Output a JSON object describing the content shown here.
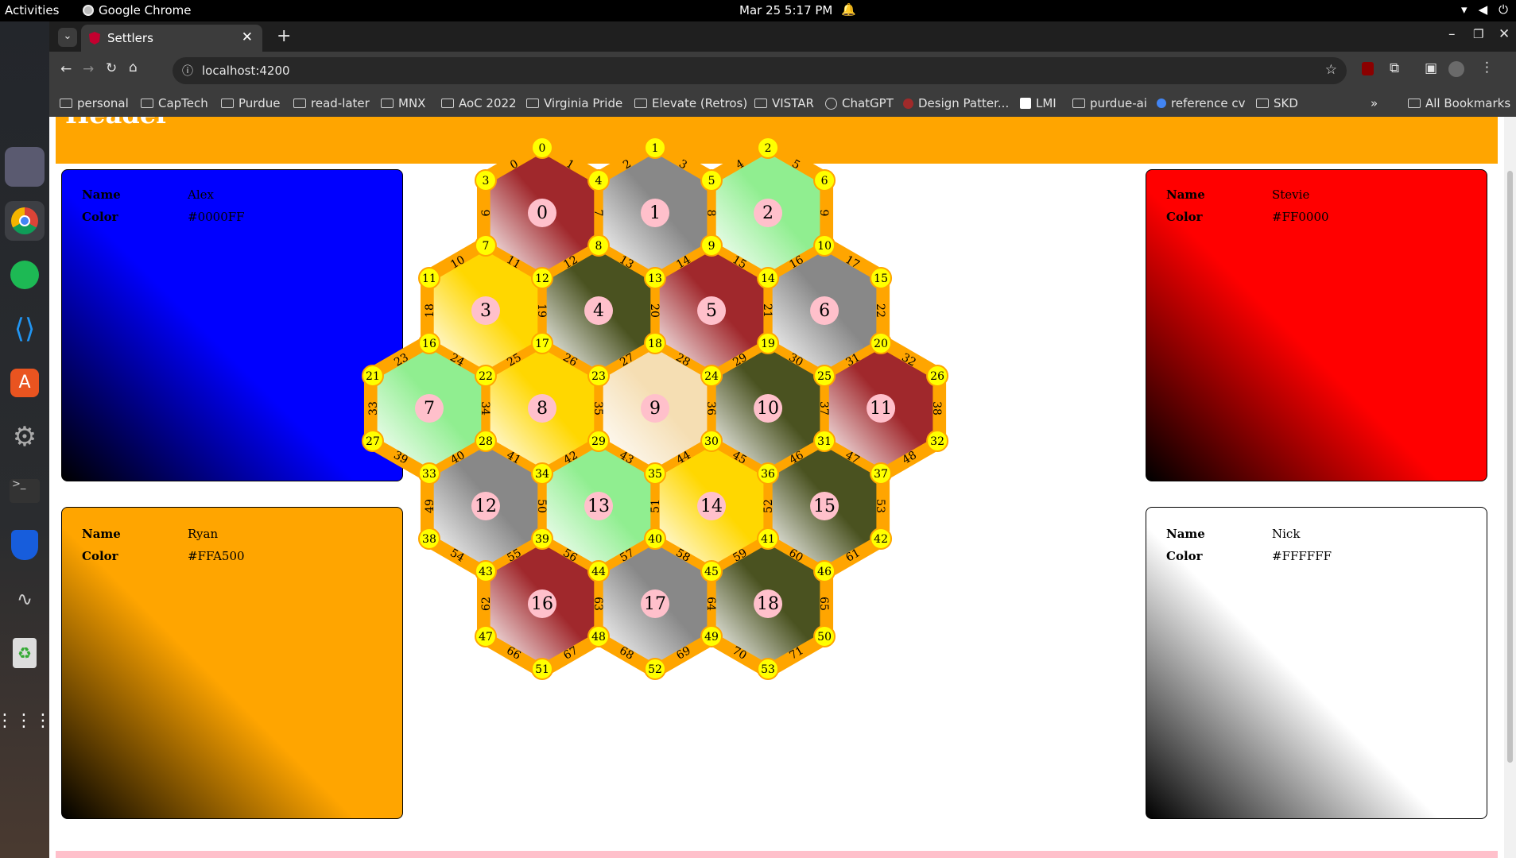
{
  "os": {
    "activities": "Activities",
    "app_name": "Google Chrome",
    "clock": "Mar 25  5:17 PM"
  },
  "browser": {
    "tab_title": "Settlers",
    "url": "localhost:4200",
    "bookmarks": [
      "personal",
      "CapTech",
      "Purdue",
      "read-later",
      "MNX",
      "AoC 2022",
      "Virginia Pride",
      "Elevate (Retros)",
      "VISTAR",
      "ChatGPT",
      "Design Patter...",
      "LMI",
      "purdue-ai",
      "reference cv",
      "SKD"
    ],
    "all_bookmarks": "All Bookmarks"
  },
  "page": {
    "header": "Header",
    "name_label": "Name",
    "color_label": "Color",
    "players": [
      {
        "name": "Alex",
        "color": "#0000FF"
      },
      {
        "name": "Ryan",
        "color": "#FFA500"
      },
      {
        "name": "Stevie",
        "color": "#FF0000"
      },
      {
        "name": "Nick",
        "color": "#FFFFFF"
      }
    ]
  },
  "board": {
    "tile_colors": {
      "brick": "#A0282C",
      "ore": "#888888",
      "grass": "#90EE90",
      "wheat": "#FFD700",
      "forest": "#4A5220",
      "desert": "#F5DEB3"
    },
    "tiles": [
      "brick",
      "ore",
      "grass",
      "wheat",
      "forest",
      "brick",
      "ore",
      "grass",
      "wheat",
      "desert",
      "forest",
      "brick",
      "ore",
      "grass",
      "wheat",
      "forest",
      "brick",
      "ore",
      "forest"
    ]
  }
}
